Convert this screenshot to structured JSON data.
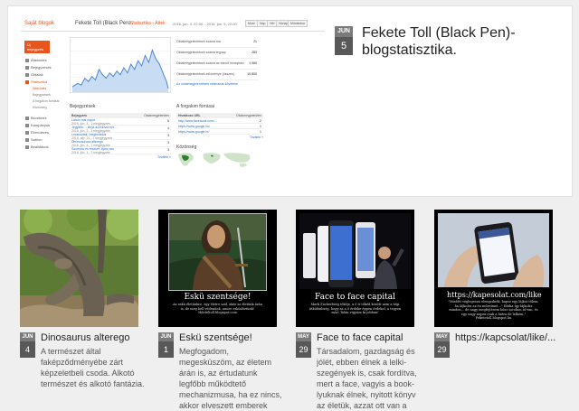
{
  "featured": {
    "date_month": "JUN",
    "date_day": "5",
    "title": "Fekete Toll (Black Pen)-blogstatisztika.",
    "screenshot": {
      "logo": "Saját blogok",
      "blog_name": "Fekete Toll (Black Pero",
      "crumbs": "› Statisztika › Áttek",
      "date_range": "2016. jún. 4. 22:00 – 2016. jún. 5. 22:00",
      "buttons": [
        "Most",
        "Nap",
        "Hét",
        "Hónap",
        "Mindenkor",
        "Minden időszak"
      ],
      "new_post": "Új bejegyzés",
      "sidebar": [
        {
          "label": "Áttekintés",
          "active": false
        },
        {
          "label": "Bejegyzések",
          "active": false
        },
        {
          "label": "Oldalak",
          "active": false
        },
        {
          "label": "Statisztika",
          "active": true
        }
      ],
      "sidebar_sub": [
        {
          "label": "Áttekintés",
          "on": true
        },
        {
          "label": "Bejegyzések",
          "on": false
        },
        {
          "label": "A forgalom forrásai",
          "on": false
        },
        {
          "label": "Közönség",
          "on": false
        }
      ],
      "sidebar_rest": [
        "Bevételek",
        "Kampányok",
        "Elrendezés",
        "Sablon",
        "Beállítások"
      ],
      "stats": [
        {
          "label": "Oldalmegjelenítések száma ma",
          "value": "21"
        },
        {
          "label": "Oldalmegjelenítések száma tegnap",
          "value": "283"
        },
        {
          "label": "Oldalmegjelenítések száma az elmúlt hónapban",
          "value": "1 060"
        },
        {
          "label": "Oldalmegjelenítések előzménye (összes)",
          "value": "10 800"
        }
      ],
      "stats_link": "Az oldalmegjelenítések számának követése",
      "posts_section": "Bejegyzések",
      "traffic_section": "A forgalom forrásai",
      "audience_section": "Közönség",
      "more_link": "További »",
      "posts_header": "Bejegyzés",
      "count_header": "Oldalmegjelenítés",
      "posts": [
        {
          "title": "Látom mai napot",
          "meta": "2016. jún. 3., 1 megjegyzés",
          "count": "5"
        },
        {
          "title": "Jegyzék: ...leírja azonkívül ezt...",
          "meta": "2016. jún. 2., 1 megjegyzés",
          "count": "4"
        },
        {
          "title": "Lecsúsztak, megfulladok",
          "meta": "2016. ápr. 22., 1 megjegyzés",
          "count": "3"
        },
        {
          "title": "Dinoszaurusz alterego",
          "meta": "2016. jún. 4., 1 megjegyzés",
          "count": "3"
        },
        {
          "title": "Szomorú és reszket, ilyen van",
          "meta": "2016. jún. 1., 1 megjegyzés",
          "count": "3"
        }
      ],
      "sources_header": "Hivatkozó URL",
      "sources": [
        {
          "url": "http://www.facebook.com/...",
          "count": "2"
        },
        {
          "url": "https://www.google.hu/",
          "count": "1"
        },
        {
          "url": "https://www.google.hr/",
          "count": "1"
        }
      ]
    }
  },
  "cards": [
    {
      "date_month": "JUN",
      "date_day": "4",
      "title": "Dinosaurus alterego",
      "excerpt": "A természet által faképződményébe zárt képzeletbeli csoda. Alkotó természet és alkotó fantázia.",
      "image": "tree-trunk-photo"
    },
    {
      "date_month": "JUN",
      "date_day": "1",
      "title": "Eskü szentsége!",
      "excerpt": "Megfogadom, megesküszöm, az életem árán is, az értudatunk legfőbb működtető mechanizmusa, ha ez nincs, akkor elveszett emberek vagyunk, nincs egyénre-szabott és egyéni karakterünk...",
      "image": "highlander-poster",
      "poster_title": "Eskü szentsége!",
      "poster_text": "Az eskü életünkre, egy életre szól, akár az életünk árán is, de meg kell védenünk, amire esküdöztünk! Hdeteltoll.blogspot.com"
    },
    {
      "date_month": "MAY",
      "date_day": "29",
      "title": "Face to face capital",
      "excerpt": "Társadalom, gazdagság és jólét, ebben élnek a lelki-szegények is, csak fordítva, mert a face, vagyis a book-lyuknak élnek, nyitott könyv az életük, azzat ott van a facebook-lyuk a fejükben, a meg nem élt semmi...",
      "image": "presentation-poster",
      "poster_title": "Face to face capital",
      "poster_text": "Mark Zuckerberg tőkéje, a ő ír tőkéd között nem a tégi útkülönbség, hogy az a ő érdeke éppen érdekel, a tegyen már! Talán vigyázz ki jobban!"
    },
    {
      "date_month": "MAY",
      "date_day": "29",
      "title": "https://kapcsolat/like/...",
      "excerpt": "",
      "image": "phone-like-poster",
      "poster_url": "https://kapesolat.com/like",
      "poster_text": "\"Mielőtt véglegesen elengednék, kapsz egy lájkot tőlem, ha lájkolsz az én műveimet...\" Hátha így lájkolsz minden... de nagy megfejtésem húsz sorokon át van, és egy nagy napra csak a hátra de lelkem.\" Feketetoll.blogspot.hu"
    }
  ]
}
